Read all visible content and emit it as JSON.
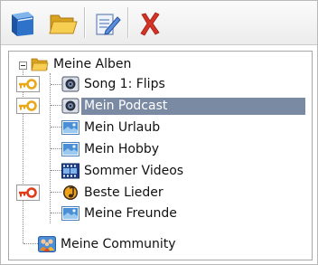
{
  "toolbar": {
    "buttons": [
      {
        "icon": "book-icon",
        "name": "album-book"
      },
      {
        "icon": "folder-open-icon",
        "name": "open-folder"
      },
      {
        "icon": "edit-document-icon",
        "name": "edit-document"
      },
      {
        "icon": "delete-x-icon",
        "name": "delete"
      }
    ]
  },
  "tree": {
    "root_label": "Meine Alben",
    "items": [
      {
        "label": "Song 1: Flips",
        "icon": "speaker-icon",
        "locked": true,
        "lock_color": "#e8a817"
      },
      {
        "label": "Mein Podcast",
        "icon": "speaker-icon",
        "locked": true,
        "lock_color": "#e8a817",
        "selected": true
      },
      {
        "label": "Mein Urlaub",
        "icon": "image-icon",
        "locked": false
      },
      {
        "label": "Mein Hobby",
        "icon": "image-icon",
        "locked": false
      },
      {
        "label": "Sommer Videos",
        "icon": "film-icon",
        "locked": false
      },
      {
        "label": "Beste Lieder",
        "icon": "music-note-icon",
        "locked": true,
        "lock_color": "#e03c1c"
      },
      {
        "label": "Meine Freunde",
        "icon": "image-icon",
        "locked": false
      }
    ],
    "community_label": "Meine Community"
  },
  "colors": {
    "selection": "#7b8aa3",
    "lock_yellow": "#e8a817",
    "lock_red": "#e03c1c"
  }
}
